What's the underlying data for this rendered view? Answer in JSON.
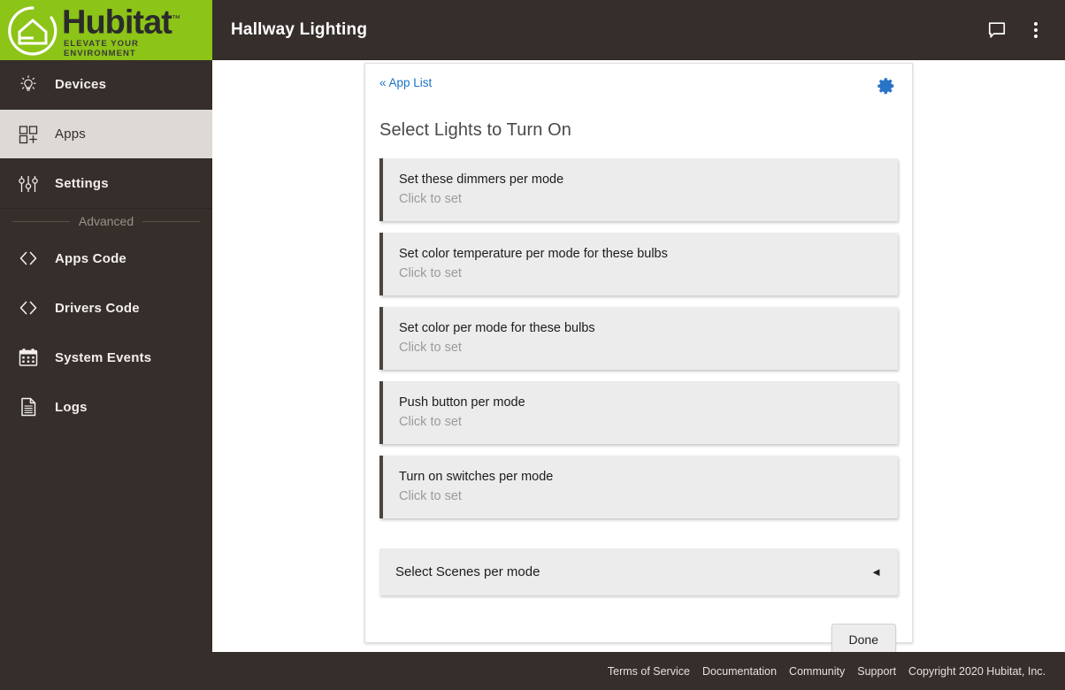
{
  "brand": {
    "name": "Hubitat",
    "trademark": "™",
    "tagline": "ELEVATE YOUR ENVIRONMENT",
    "green": "#8cc417"
  },
  "sidebar": {
    "items": [
      {
        "label": "Devices",
        "icon": "lightbulb-icon",
        "active": false
      },
      {
        "label": "Apps",
        "icon": "apps-grid-icon",
        "active": true
      },
      {
        "label": "Settings",
        "icon": "sliders-icon",
        "active": false
      }
    ],
    "divider_label": "Advanced",
    "advanced_items": [
      {
        "label": "Apps Code",
        "icon": "code-brackets-icon"
      },
      {
        "label": "Drivers Code",
        "icon": "code-brackets-icon"
      },
      {
        "label": "System Events",
        "icon": "calendar-icon"
      },
      {
        "label": "Logs",
        "icon": "document-icon"
      }
    ]
  },
  "topbar": {
    "title": "Hallway Lighting",
    "chat_icon": "chat-bubble-icon",
    "menu_icon": "overflow-menu-icon"
  },
  "card": {
    "back_link": "« App List",
    "gear_icon": "gear-icon",
    "gear_color": "#2a74c8",
    "title": "Select Lights to Turn On",
    "options": [
      {
        "title": "Set these dimmers per mode",
        "subtitle": "Click to set"
      },
      {
        "title": "Set color temperature per mode for these bulbs",
        "subtitle": "Click to set"
      },
      {
        "title": "Set color per mode for these bulbs",
        "subtitle": "Click to set"
      },
      {
        "title": "Push button per mode",
        "subtitle": "Click to set"
      },
      {
        "title": "Turn on switches per mode",
        "subtitle": "Click to set"
      }
    ],
    "scenes": {
      "label": "Select Scenes per mode",
      "caret": "◄",
      "caret_icon": "caret-left-icon"
    },
    "done_label": "Done"
  },
  "footer": {
    "links": [
      "Terms of Service",
      "Documentation",
      "Community",
      "Support"
    ],
    "copyright": "Copyright 2020 Hubitat, Inc."
  }
}
